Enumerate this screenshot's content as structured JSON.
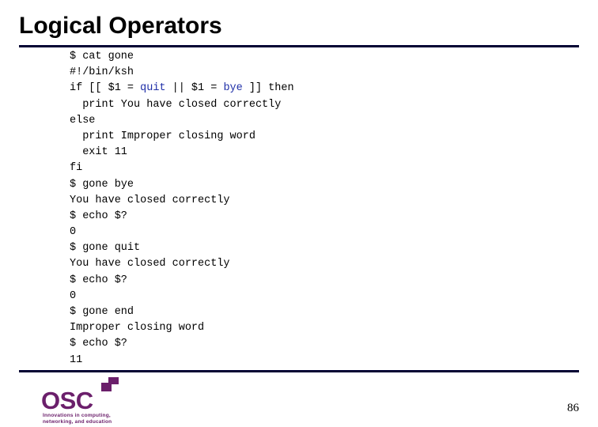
{
  "slide": {
    "title": "Logical Operators",
    "page_number": "86",
    "colors": {
      "rule": "#000033",
      "keyword": "#1f2fa8",
      "logo": "#6b1f6b"
    },
    "code_lines": [
      [
        {
          "t": "$ cat gone",
          "k": false
        }
      ],
      [
        {
          "t": "#!/bin/ksh",
          "k": false
        }
      ],
      [
        {
          "t": "if [[ $1 = ",
          "k": false
        },
        {
          "t": "quit",
          "k": true
        },
        {
          "t": " || $1 = ",
          "k": false
        },
        {
          "t": "bye",
          "k": true
        },
        {
          "t": " ]] then",
          "k": false
        }
      ],
      [
        {
          "t": "  print You have closed correctly",
          "k": false
        }
      ],
      [
        {
          "t": "else",
          "k": false
        }
      ],
      [
        {
          "t": "  print Improper closing word",
          "k": false
        }
      ],
      [
        {
          "t": "  exit 11",
          "k": false
        }
      ],
      [
        {
          "t": "fi",
          "k": false
        }
      ],
      [
        {
          "t": "$ gone bye",
          "k": false
        }
      ],
      [
        {
          "t": "You have closed correctly",
          "k": false
        }
      ],
      [
        {
          "t": "$ echo $?",
          "k": false
        }
      ],
      [
        {
          "t": "0",
          "k": false
        }
      ],
      [
        {
          "t": "$ gone quit",
          "k": false
        }
      ],
      [
        {
          "t": "You have closed correctly",
          "k": false
        }
      ],
      [
        {
          "t": "$ echo $?",
          "k": false
        }
      ],
      [
        {
          "t": "0",
          "k": false
        }
      ],
      [
        {
          "t": "$ gone end",
          "k": false
        }
      ],
      [
        {
          "t": "Improper closing word",
          "k": false
        }
      ],
      [
        {
          "t": "$ echo $?",
          "k": false
        }
      ],
      [
        {
          "t": "11",
          "k": false
        }
      ]
    ],
    "logo": {
      "name": "OSC",
      "tagline_line1": "Innovations in computing,",
      "tagline_line2": "networking, and education"
    }
  }
}
